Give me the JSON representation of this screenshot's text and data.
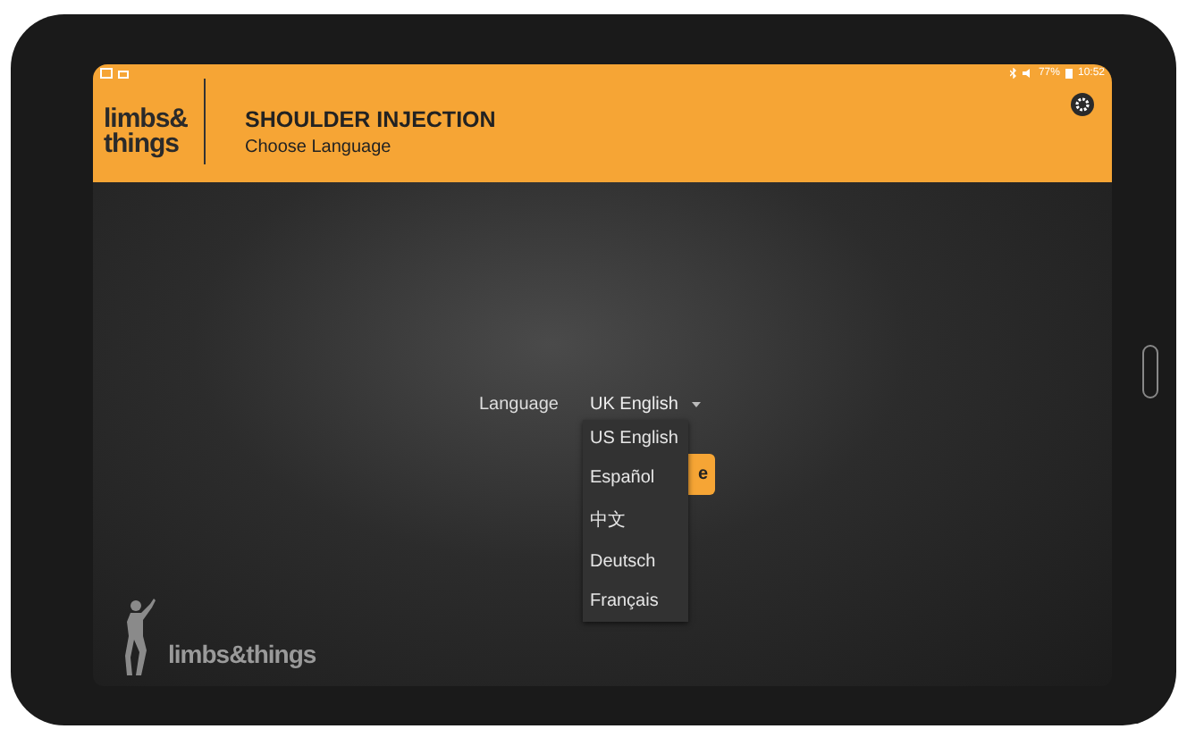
{
  "status_bar": {
    "battery": "77%",
    "time": "10:52"
  },
  "header": {
    "logo": [
      "limbs&",
      "things"
    ],
    "title": "SHOULDER INJECTION",
    "subtitle": "Choose Language"
  },
  "form": {
    "label": "Language",
    "value": "UK English",
    "button": "e"
  },
  "dropdown": [
    {
      "label": "US English",
      "selected": false
    },
    {
      "label": "Español",
      "selected": false
    },
    {
      "label": "中文",
      "selected": false
    },
    {
      "label": "Deutsch",
      "selected": false
    },
    {
      "label": "Français",
      "selected": false
    }
  ],
  "footer": {
    "brand": "limbs&things"
  }
}
